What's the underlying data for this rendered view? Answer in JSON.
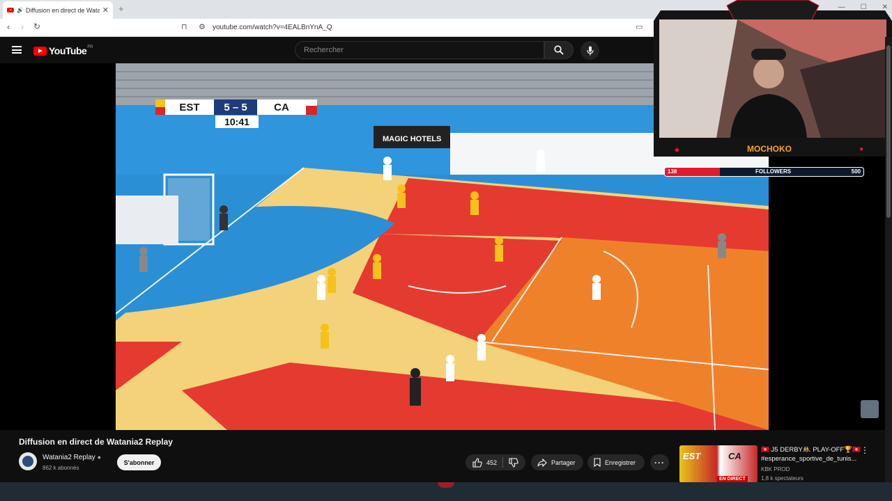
{
  "browser": {
    "tab_title": "Diffusion en direct de Watan",
    "url": "youtube.com/watch?v=4EALBnYnA_Q"
  },
  "youtube": {
    "logo_text": "YouTube",
    "country_code": "FR",
    "search_placeholder": "Rechercher"
  },
  "video": {
    "scoreboard": {
      "home": "EST",
      "score": "5 – 5",
      "away": "CA",
      "clock": "10:41"
    },
    "hoarding_text": "MAGIC HOTELS"
  },
  "stream_overlay": {
    "streamer_name": "MOCHOKO",
    "followers_label": "FOLLOWERS",
    "followers_current": "138",
    "followers_goal": "500",
    "followers_progress": 0.276
  },
  "info": {
    "title": "Diffusion en direct de Watania2 Replay",
    "channel_name": "Watania2 Replay",
    "subscribers": "862 k abonnés",
    "subscribe_label": "S'abonner",
    "likes": "452",
    "share_label": "Partager",
    "save_label": "Enregistrer"
  },
  "related": {
    "title_line1": "🇹🇳 J5 DERBY🤼 PLAY-OFF🏆🇹🇳",
    "title_line2": "#esperance_sportive_de_tunis...",
    "channel": "KBK PROD",
    "viewers": "1,8 k spectateurs",
    "thumb_home": "EST",
    "thumb_away": "CA",
    "thumb_badge": "EN DIRECT"
  },
  "colors": {
    "yt_red": "#ff0000",
    "court_orange": "#f0812b",
    "court_red": "#e53a2f",
    "court_yellow": "#f3d27a",
    "court_blue": "#2b8fd6",
    "overlay_red": "#e21b2b"
  }
}
